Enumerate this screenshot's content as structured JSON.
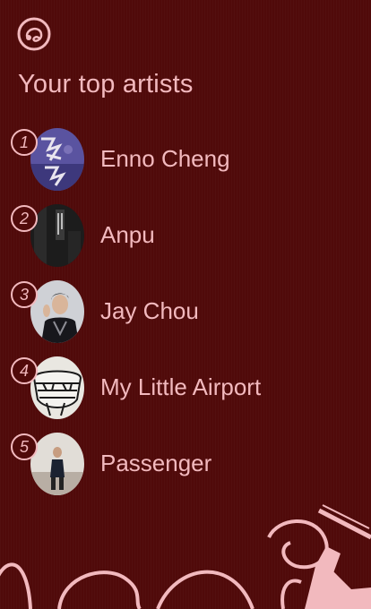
{
  "header": {
    "title": "Your top artists",
    "logo_icon": "vinyl-headphones-icon"
  },
  "artists": [
    {
      "rank": "1",
      "name": "Enno Cheng"
    },
    {
      "rank": "2",
      "name": "Anpu"
    },
    {
      "rank": "3",
      "name": "Jay Chou"
    },
    {
      "rank": "4",
      "name": "My Little Airport"
    },
    {
      "rank": "5",
      "name": "Passenger"
    }
  ],
  "colors": {
    "background": "#500a0a",
    "accent": "#f2b9be"
  }
}
